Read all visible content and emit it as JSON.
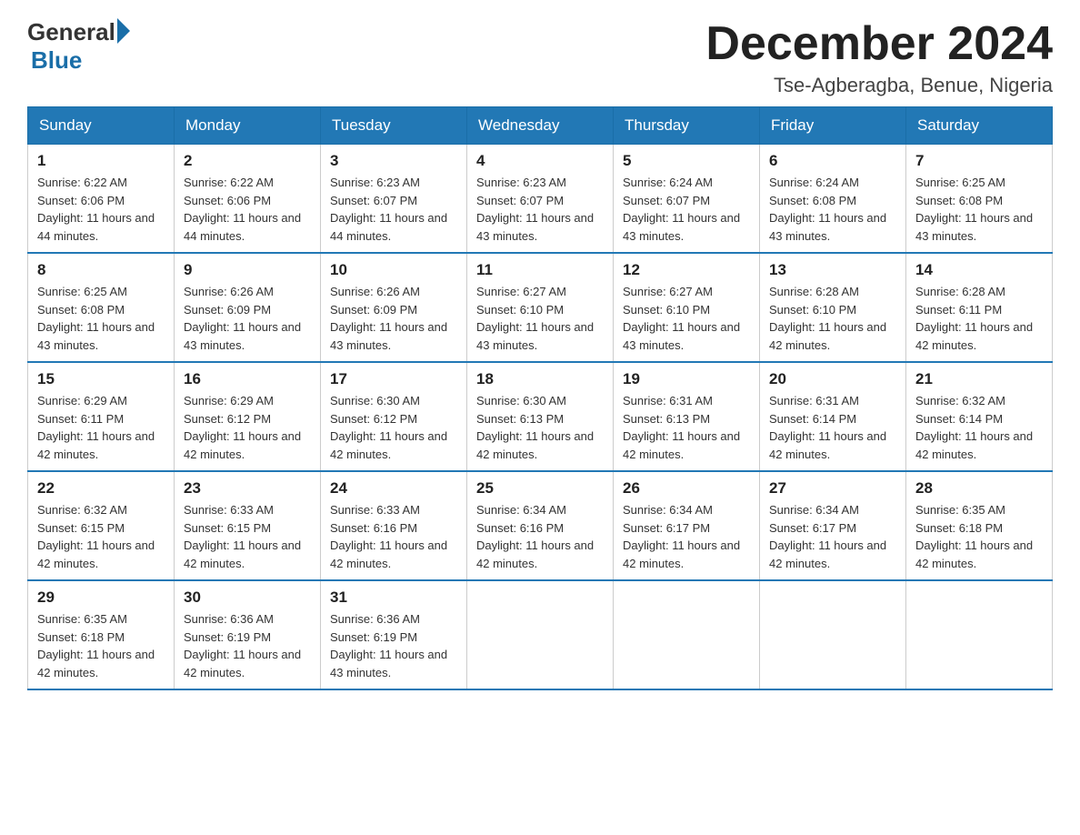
{
  "logo": {
    "text_general": "General",
    "text_blue": "Blue"
  },
  "title": "December 2024",
  "location": "Tse-Agberagba, Benue, Nigeria",
  "weekdays": [
    "Sunday",
    "Monday",
    "Tuesday",
    "Wednesday",
    "Thursday",
    "Friday",
    "Saturday"
  ],
  "weeks": [
    [
      {
        "day": "1",
        "sunrise": "Sunrise: 6:22 AM",
        "sunset": "Sunset: 6:06 PM",
        "daylight": "Daylight: 11 hours and 44 minutes."
      },
      {
        "day": "2",
        "sunrise": "Sunrise: 6:22 AM",
        "sunset": "Sunset: 6:06 PM",
        "daylight": "Daylight: 11 hours and 44 minutes."
      },
      {
        "day": "3",
        "sunrise": "Sunrise: 6:23 AM",
        "sunset": "Sunset: 6:07 PM",
        "daylight": "Daylight: 11 hours and 44 minutes."
      },
      {
        "day": "4",
        "sunrise": "Sunrise: 6:23 AM",
        "sunset": "Sunset: 6:07 PM",
        "daylight": "Daylight: 11 hours and 43 minutes."
      },
      {
        "day": "5",
        "sunrise": "Sunrise: 6:24 AM",
        "sunset": "Sunset: 6:07 PM",
        "daylight": "Daylight: 11 hours and 43 minutes."
      },
      {
        "day": "6",
        "sunrise": "Sunrise: 6:24 AM",
        "sunset": "Sunset: 6:08 PM",
        "daylight": "Daylight: 11 hours and 43 minutes."
      },
      {
        "day": "7",
        "sunrise": "Sunrise: 6:25 AM",
        "sunset": "Sunset: 6:08 PM",
        "daylight": "Daylight: 11 hours and 43 minutes."
      }
    ],
    [
      {
        "day": "8",
        "sunrise": "Sunrise: 6:25 AM",
        "sunset": "Sunset: 6:08 PM",
        "daylight": "Daylight: 11 hours and 43 minutes."
      },
      {
        "day": "9",
        "sunrise": "Sunrise: 6:26 AM",
        "sunset": "Sunset: 6:09 PM",
        "daylight": "Daylight: 11 hours and 43 minutes."
      },
      {
        "day": "10",
        "sunrise": "Sunrise: 6:26 AM",
        "sunset": "Sunset: 6:09 PM",
        "daylight": "Daylight: 11 hours and 43 minutes."
      },
      {
        "day": "11",
        "sunrise": "Sunrise: 6:27 AM",
        "sunset": "Sunset: 6:10 PM",
        "daylight": "Daylight: 11 hours and 43 minutes."
      },
      {
        "day": "12",
        "sunrise": "Sunrise: 6:27 AM",
        "sunset": "Sunset: 6:10 PM",
        "daylight": "Daylight: 11 hours and 43 minutes."
      },
      {
        "day": "13",
        "sunrise": "Sunrise: 6:28 AM",
        "sunset": "Sunset: 6:10 PM",
        "daylight": "Daylight: 11 hours and 42 minutes."
      },
      {
        "day": "14",
        "sunrise": "Sunrise: 6:28 AM",
        "sunset": "Sunset: 6:11 PM",
        "daylight": "Daylight: 11 hours and 42 minutes."
      }
    ],
    [
      {
        "day": "15",
        "sunrise": "Sunrise: 6:29 AM",
        "sunset": "Sunset: 6:11 PM",
        "daylight": "Daylight: 11 hours and 42 minutes."
      },
      {
        "day": "16",
        "sunrise": "Sunrise: 6:29 AM",
        "sunset": "Sunset: 6:12 PM",
        "daylight": "Daylight: 11 hours and 42 minutes."
      },
      {
        "day": "17",
        "sunrise": "Sunrise: 6:30 AM",
        "sunset": "Sunset: 6:12 PM",
        "daylight": "Daylight: 11 hours and 42 minutes."
      },
      {
        "day": "18",
        "sunrise": "Sunrise: 6:30 AM",
        "sunset": "Sunset: 6:13 PM",
        "daylight": "Daylight: 11 hours and 42 minutes."
      },
      {
        "day": "19",
        "sunrise": "Sunrise: 6:31 AM",
        "sunset": "Sunset: 6:13 PM",
        "daylight": "Daylight: 11 hours and 42 minutes."
      },
      {
        "day": "20",
        "sunrise": "Sunrise: 6:31 AM",
        "sunset": "Sunset: 6:14 PM",
        "daylight": "Daylight: 11 hours and 42 minutes."
      },
      {
        "day": "21",
        "sunrise": "Sunrise: 6:32 AM",
        "sunset": "Sunset: 6:14 PM",
        "daylight": "Daylight: 11 hours and 42 minutes."
      }
    ],
    [
      {
        "day": "22",
        "sunrise": "Sunrise: 6:32 AM",
        "sunset": "Sunset: 6:15 PM",
        "daylight": "Daylight: 11 hours and 42 minutes."
      },
      {
        "day": "23",
        "sunrise": "Sunrise: 6:33 AM",
        "sunset": "Sunset: 6:15 PM",
        "daylight": "Daylight: 11 hours and 42 minutes."
      },
      {
        "day": "24",
        "sunrise": "Sunrise: 6:33 AM",
        "sunset": "Sunset: 6:16 PM",
        "daylight": "Daylight: 11 hours and 42 minutes."
      },
      {
        "day": "25",
        "sunrise": "Sunrise: 6:34 AM",
        "sunset": "Sunset: 6:16 PM",
        "daylight": "Daylight: 11 hours and 42 minutes."
      },
      {
        "day": "26",
        "sunrise": "Sunrise: 6:34 AM",
        "sunset": "Sunset: 6:17 PM",
        "daylight": "Daylight: 11 hours and 42 minutes."
      },
      {
        "day": "27",
        "sunrise": "Sunrise: 6:34 AM",
        "sunset": "Sunset: 6:17 PM",
        "daylight": "Daylight: 11 hours and 42 minutes."
      },
      {
        "day": "28",
        "sunrise": "Sunrise: 6:35 AM",
        "sunset": "Sunset: 6:18 PM",
        "daylight": "Daylight: 11 hours and 42 minutes."
      }
    ],
    [
      {
        "day": "29",
        "sunrise": "Sunrise: 6:35 AM",
        "sunset": "Sunset: 6:18 PM",
        "daylight": "Daylight: 11 hours and 42 minutes."
      },
      {
        "day": "30",
        "sunrise": "Sunrise: 6:36 AM",
        "sunset": "Sunset: 6:19 PM",
        "daylight": "Daylight: 11 hours and 42 minutes."
      },
      {
        "day": "31",
        "sunrise": "Sunrise: 6:36 AM",
        "sunset": "Sunset: 6:19 PM",
        "daylight": "Daylight: 11 hours and 43 minutes."
      },
      null,
      null,
      null,
      null
    ]
  ]
}
